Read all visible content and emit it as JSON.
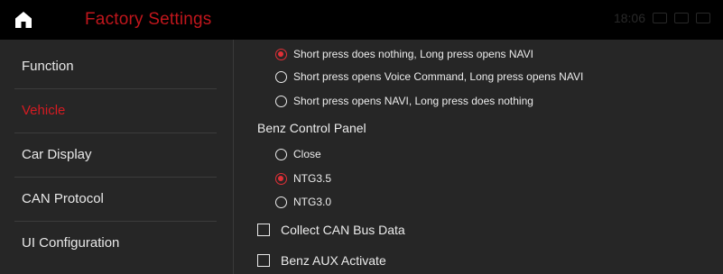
{
  "header": {
    "title": "Factory Settings",
    "home_icon": "home-icon",
    "status_time": "18:06",
    "status_icons": [
      "bluetooth-icon",
      "usb-icon",
      "screen-icon",
      "battery-icon"
    ]
  },
  "sidebar": {
    "items": [
      {
        "label": "Function",
        "active": false
      },
      {
        "label": "Vehicle",
        "active": true
      },
      {
        "label": "Car Display",
        "active": false
      },
      {
        "label": "CAN Protocol",
        "active": false
      },
      {
        "label": "UI Configuration",
        "active": false
      }
    ]
  },
  "main": {
    "button_options": [
      {
        "label": "Short press does nothing, Long press opens NAVI",
        "selected": true
      },
      {
        "label": "Short press opens Voice Command, Long press opens NAVI",
        "selected": false
      },
      {
        "label": "Short press opens NAVI, Long press does nothing",
        "selected": false
      }
    ],
    "benz_panel": {
      "title": "Benz Control Panel",
      "options": [
        {
          "label": "Close",
          "selected": false
        },
        {
          "label": "NTG3.5",
          "selected": true
        },
        {
          "label": "NTG3.0",
          "selected": false
        }
      ]
    },
    "checkboxes": [
      {
        "label": "Collect CAN Bus Data",
        "checked": false
      },
      {
        "label": "Benz AUX Activate",
        "checked": false
      }
    ]
  },
  "colors": {
    "accent": "#d51b22",
    "background": "#262626",
    "topbar": "#000000"
  }
}
